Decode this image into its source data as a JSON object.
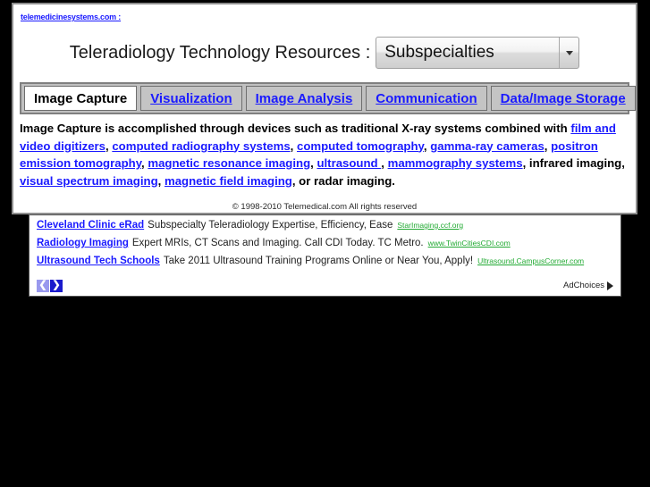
{
  "site": {
    "link_text": "telemedicinesystems.com :"
  },
  "header": {
    "title": "Teleradiology Technology Resources :",
    "select": {
      "value": "Subspecialties",
      "caret_icon": "chevron-down-icon"
    }
  },
  "tabs": [
    {
      "label": "Image Capture",
      "active": true
    },
    {
      "label": "Visualization",
      "active": false
    },
    {
      "label": "Image Analysis",
      "active": false
    },
    {
      "label": "Communication",
      "active": false
    },
    {
      "label": "Data/Image Storage",
      "active": false
    }
  ],
  "body": {
    "segments": [
      {
        "text": "Image Capture is accomplished through devices such as traditional X-ray systems combined with ",
        "link": false
      },
      {
        "text": "film and video digitizers",
        "link": true
      },
      {
        "text": ", ",
        "link": false
      },
      {
        "text": "computed radiography systems",
        "link": true
      },
      {
        "text": ", ",
        "link": false
      },
      {
        "text": "computed tomography",
        "link": true
      },
      {
        "text": ", ",
        "link": false
      },
      {
        "text": "gamma-ray cameras",
        "link": true
      },
      {
        "text": ", ",
        "link": false
      },
      {
        "text": "positron emission tomography",
        "link": true
      },
      {
        "text": ", ",
        "link": false
      },
      {
        "text": "magnetic resonance imaging",
        "link": true
      },
      {
        "text": ", ",
        "link": false
      },
      {
        "text": "ultrasound ",
        "link": true
      },
      {
        "text": ", ",
        "link": false
      },
      {
        "text": "mammography systems",
        "link": true
      },
      {
        "text": ", infrared imaging, ",
        "link": false
      },
      {
        "text": "visual spectrum imaging",
        "link": true
      },
      {
        "text": ", ",
        "link": false
      },
      {
        "text": "magnetic field imaging",
        "link": true
      },
      {
        "text": ", or radar imaging.",
        "link": false
      }
    ]
  },
  "copyright": "© 1998-2010 Telemedical.com All rights reserved",
  "ads": {
    "items": [
      {
        "title": "Cleveland Clinic eRad",
        "description": "Subspecialty Teleradiology Expertise, Efficiency, Ease",
        "url": "StarImaging.ccf.org"
      },
      {
        "title": "Radiology Imaging",
        "description": "Expert MRIs, CT Scans and Imaging. Call CDI Today. TC Metro.",
        "url": "www.TwinCitiesCDI.com"
      },
      {
        "title": "Ultrasound Tech Schools",
        "description": "Take 2011 Ultrasound Training Programs Online or Near You, Apply!",
        "url": "Ultrasound.CampusCorner.com"
      }
    ],
    "nav": {
      "prev_glyph": "❮",
      "next_glyph": "❯"
    },
    "adchoices_label": "AdChoices",
    "adchoices_icon": "adchoices-triangle-icon"
  },
  "colors": {
    "link_blue": "#1a1aff",
    "ad_url_green": "#22aa33",
    "page_background": "#000000",
    "panel_background": "#ffffff",
    "tab_bar_gray": "#c0c0c0"
  }
}
